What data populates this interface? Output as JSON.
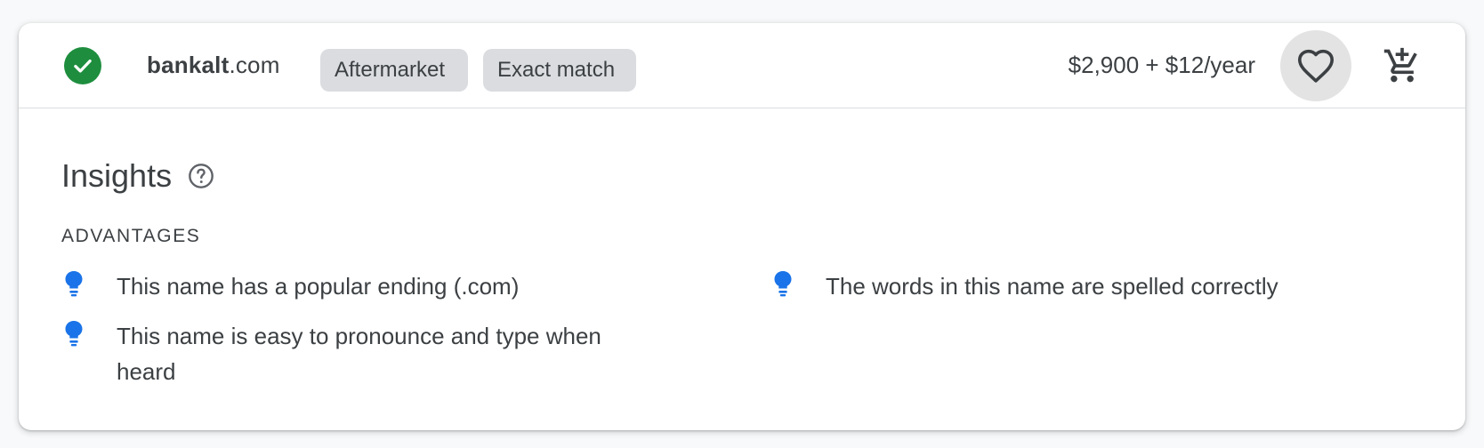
{
  "result": {
    "domain_sld": "bankalt",
    "domain_tld": ".com",
    "chips": [
      "Aftermarket",
      "Exact match"
    ],
    "price": "$2,900 + $12/year",
    "available_icon": "check-circle-icon",
    "favorite_icon": "heart-outline-icon",
    "cart_icon": "add-shopping-cart-icon"
  },
  "insights": {
    "title": "Insights",
    "help_icon": "help-circle-icon",
    "section_label": "ADVANTAGES",
    "advantages": [
      "This name has a popular ending (.com)",
      "This name is easy to pronounce and type when heard",
      "The words in this name are spelled correctly"
    ],
    "bullet_icon": "lightbulb-icon"
  },
  "colors": {
    "available_green": "#1e8e3e",
    "bulb_blue": "#1a73e8",
    "chip_bg": "#dadce0",
    "fav_bg": "#e3e3e3"
  }
}
